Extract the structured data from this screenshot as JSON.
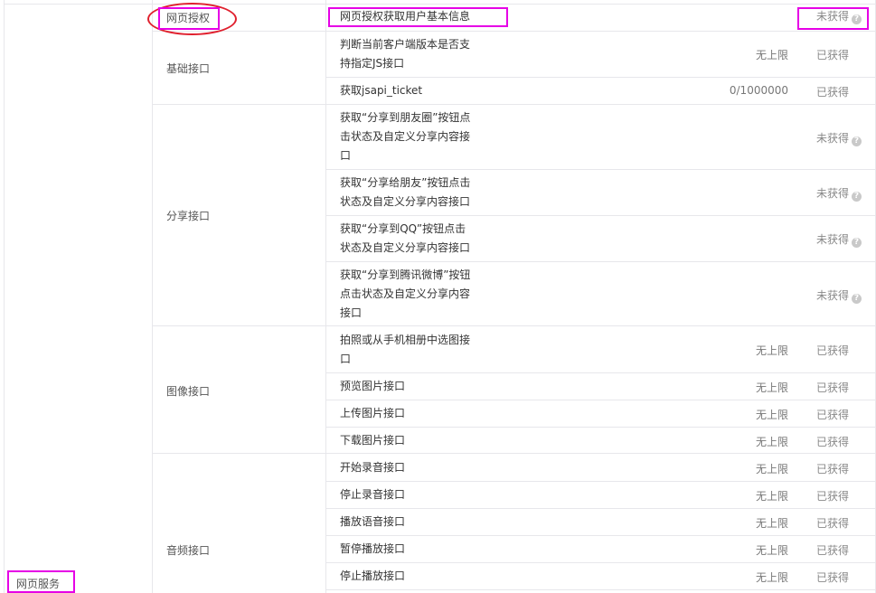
{
  "left_section": {
    "label": "网页服务"
  },
  "groups": [
    {
      "name": "网页授权",
      "rows": [
        {
          "name": "网页授权获取用户基本信息",
          "limit": "",
          "status": "未获得",
          "help": true
        }
      ]
    },
    {
      "name": "基础接口",
      "rows": [
        {
          "name": "判断当前客户端版本是否支持指定JS接口",
          "limit": "无上限",
          "status": "已获得",
          "help": false
        },
        {
          "name": "获取jsapi_ticket",
          "limit": "0/1000000",
          "status": "已获得",
          "help": false
        }
      ]
    },
    {
      "name": "分享接口",
      "rows": [
        {
          "name": "获取“分享到朋友圈”按钮点击状态及自定义分享内容接口",
          "limit": "",
          "status": "未获得",
          "help": true
        },
        {
          "name": "获取“分享给朋友”按钮点击状态及自定义分享内容接口",
          "limit": "",
          "status": "未获得",
          "help": true
        },
        {
          "name": "获取“分享到QQ”按钮点击状态及自定义分享内容接口",
          "limit": "",
          "status": "未获得",
          "help": true
        },
        {
          "name": "获取“分享到腾讯微博”按钮点击状态及自定义分享内容接口",
          "limit": "",
          "status": "未获得",
          "help": true
        }
      ]
    },
    {
      "name": "图像接口",
      "rows": [
        {
          "name": "拍照或从手机相册中选图接口",
          "limit": "无上限",
          "status": "已获得",
          "help": false
        },
        {
          "name": "预览图片接口",
          "limit": "无上限",
          "status": "已获得",
          "help": false
        },
        {
          "name": "上传图片接口",
          "limit": "无上限",
          "status": "已获得",
          "help": false
        },
        {
          "name": "下载图片接口",
          "limit": "无上限",
          "status": "已获得",
          "help": false
        }
      ]
    },
    {
      "name": "音频接口",
      "rows": [
        {
          "name": "开始录音接口",
          "limit": "无上限",
          "status": "已获得",
          "help": false
        },
        {
          "name": "停止录音接口",
          "limit": "无上限",
          "status": "已获得",
          "help": false
        },
        {
          "name": "播放语音接口",
          "limit": "无上限",
          "status": "已获得",
          "help": false
        },
        {
          "name": "暂停播放接口",
          "limit": "无上限",
          "status": "已获得",
          "help": false
        },
        {
          "name": "停止播放接口",
          "limit": "无上限",
          "status": "已获得",
          "help": false
        }
      ]
    }
  ],
  "colors": {
    "border": "#e7e7eb",
    "highlight": "#e600e6",
    "circle": "#e0202e"
  },
  "icons": {
    "help": "question-circle-icon"
  }
}
